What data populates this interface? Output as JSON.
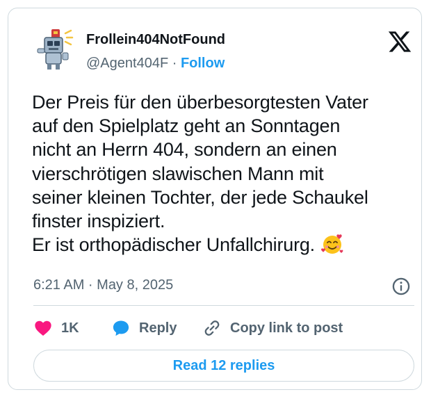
{
  "tweet": {
    "display_name": "Frollein404NotFound",
    "handle": "@Agent404F",
    "separator": " · ",
    "follow_label": "Follow",
    "text": "Der Preis für den überbesorgtesten Vater\nauf den Spielplatz geht an Sonntagen\nnicht an Herrn 404, sondern an einen\nvierschrötigen slawischen Mann mit\nseiner kleinen Tochter, der jede Schaukel\nfinster inspiziert.\nEr ist orthopädischer Unfallchirurg. ",
    "emoji": "smiling-face-with-hearts-icon",
    "timestamp": "6:21 AM · May 8, 2025"
  },
  "actions": {
    "like_count": "1K",
    "reply_label": "Reply",
    "copy_link_label": "Copy link to post"
  },
  "read_replies_label": "Read 12 replies",
  "colors": {
    "accent": "#1d9bf0",
    "like": "#f91880",
    "secondary_text": "#536471",
    "border": "#cfd9de"
  }
}
